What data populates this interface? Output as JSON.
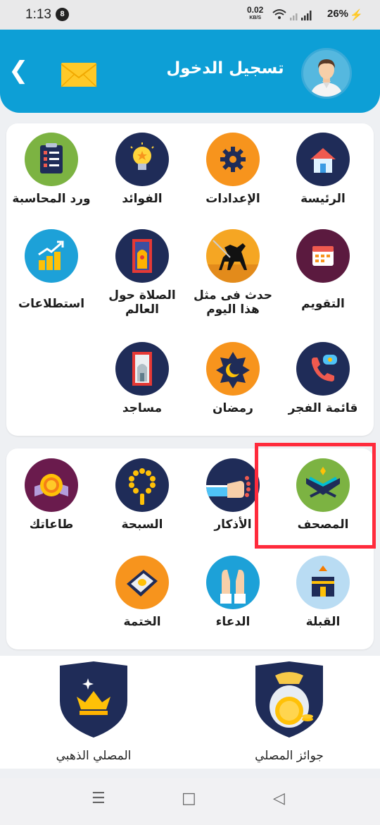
{
  "status_bar": {
    "time": "1:13",
    "notification_count": "8",
    "net_speed": "0.02",
    "net_unit": "KB/S",
    "battery": "26%"
  },
  "header": {
    "title": "تسجيل الدخول",
    "back_icon": "chevron-left",
    "mail_icon": "envelope",
    "avatar_icon": "user-avatar",
    "color": "#0d9fd6"
  },
  "menu_main": [
    {
      "label": "الرئيسة",
      "icon": "home-icon"
    },
    {
      "label": "الإعدادات",
      "icon": "gear-icon"
    },
    {
      "label": "الفوائد",
      "icon": "lightbulb-icon"
    },
    {
      "label": "ورد المحاسبة",
      "icon": "checklist-icon"
    },
    {
      "label": "التقويم",
      "icon": "calendar-icon"
    },
    {
      "label": "حدث فى مثل هذا اليوم",
      "icon": "horse-rider-icon"
    },
    {
      "label": "الصلاة حول العالم",
      "icon": "prayer-rug-icon"
    },
    {
      "label": "استطلاعات",
      "icon": "bar-chart-icon"
    },
    {
      "label": "قائمة الفجر",
      "icon": "phone-call-icon"
    },
    {
      "label": "رمضان",
      "icon": "crescent-moon-icon"
    },
    {
      "label": "مساجد",
      "icon": "mosque-icon"
    }
  ],
  "menu_worship": [
    {
      "label": "المصحف",
      "icon": "quran-icon"
    },
    {
      "label": "الأذكار",
      "icon": "prayer-beads-hand-icon"
    },
    {
      "label": "السبحة",
      "icon": "tasbih-icon"
    },
    {
      "label": "طاعاتك",
      "icon": "medal-icon"
    },
    {
      "label": "القبلة",
      "icon": "kaaba-icon"
    },
    {
      "label": "الدعاء",
      "icon": "praying-hands-icon"
    },
    {
      "label": "الختمة",
      "icon": "book-icon"
    }
  ],
  "awards": {
    "left_label": "المصلي الذهبي",
    "right_label": "جوائز المصلي",
    "left_icon": "crown-shield-icon",
    "right_icon": "coin-bag-shield-icon"
  },
  "highlight_color": "#ff2b3c"
}
